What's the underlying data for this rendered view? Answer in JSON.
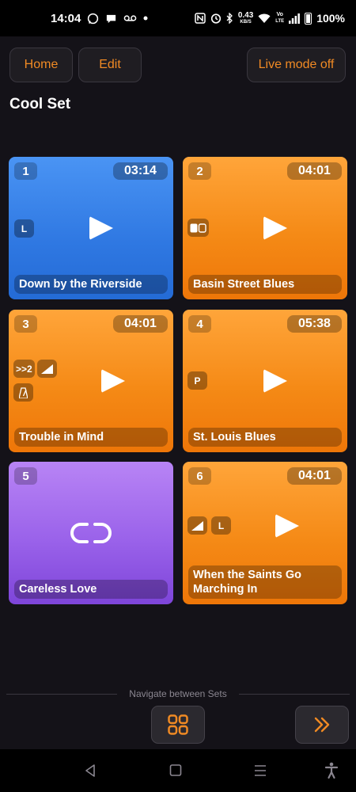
{
  "status_bar": {
    "time": "14:04",
    "speed_value": "0.43",
    "speed_unit": "KB/S",
    "volte_top": "Vo",
    "volte_bottom": "LTE",
    "battery": "100%"
  },
  "header": {
    "home_label": "Home",
    "edit_label": "Edit",
    "live_label": "Live mode off",
    "set_title": "Cool Set"
  },
  "colors": {
    "accent": "#f08a24",
    "tile_blue": "#2f78e2",
    "tile_orange": "#f58a16",
    "tile_purple": "#9a62ea"
  },
  "tiles": [
    {
      "number": "1",
      "duration": "03:14",
      "title": "Down by the Riverside",
      "badges": [
        "L"
      ],
      "color": "blue",
      "icon": "play-icon"
    },
    {
      "number": "2",
      "duration": "04:01",
      "title": "Basin Street Blues",
      "badges": [
        "dual-pad-icon"
      ],
      "color": "orange",
      "icon": "play-icon"
    },
    {
      "number": "3",
      "duration": "04:01",
      "title": "Trouble in Mind",
      "badges": [
        ">>2",
        "ramp-icon",
        "metronome-icon"
      ],
      "color": "orange",
      "icon": "play-icon"
    },
    {
      "number": "4",
      "duration": "05:38",
      "title": "St. Louis Blues",
      "badges": [
        "P"
      ],
      "color": "orange",
      "icon": "play-icon"
    },
    {
      "number": "5",
      "title": "Careless Love",
      "badges": [],
      "color": "purple",
      "icon": "loop-icon"
    },
    {
      "number": "6",
      "duration": "04:01",
      "title": "When the Saints Go Marching In",
      "badges": [
        "ramp-icon",
        "L"
      ],
      "color": "orange",
      "icon": "play-icon"
    }
  ],
  "footer": {
    "navigate_label": "Navigate between Sets",
    "grid_icon": "grid-icon",
    "next_icon": "double-chevron-right-icon"
  },
  "system_nav": [
    "back-icon",
    "home-icon",
    "recents-icon",
    "accessibility-icon"
  ]
}
